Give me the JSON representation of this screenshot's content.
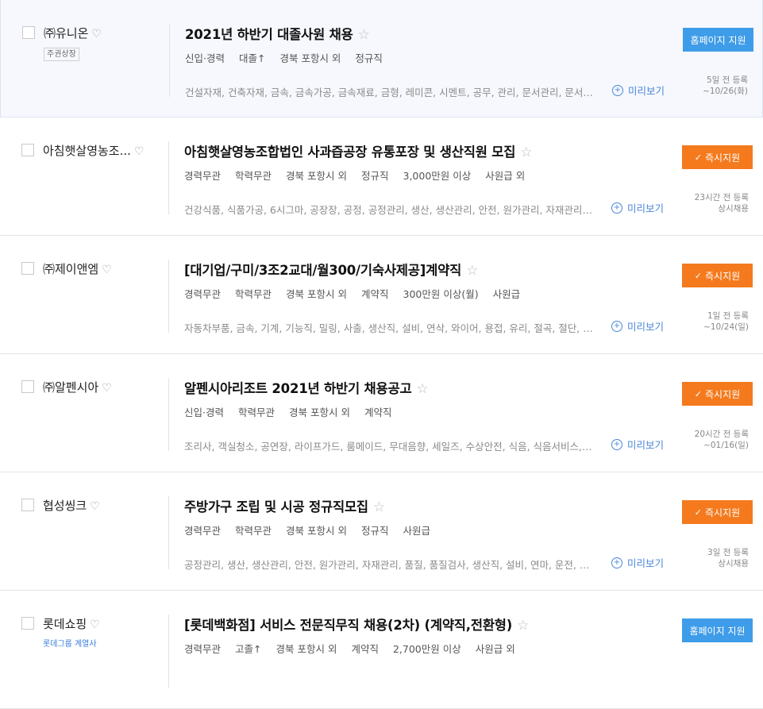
{
  "jobs": [
    {
      "company": "㈜유니온",
      "tag": "주권상장",
      "tag_type": "listed",
      "title": "2021년 하반기 대졸사원 채용",
      "conditions": [
        "신입·경력",
        "대졸↑",
        "경북 포항시 외",
        "정규직"
      ],
      "keywords": "건설자재, 건축자재, 금속, 금속가공, 금속재료, 금형, 레미콘, 시멘트, 공무, 관리, 문서관리, 문서수...",
      "preview_label": "미리보기",
      "button_label": "홈페이지 지원",
      "button_type": "home",
      "posted": "5일 전 등록",
      "deadline": "~10/26(화)"
    },
    {
      "company": "아침햇살영농조...",
      "tag": "",
      "tag_type": "",
      "title": "아침햇살영농조합법인 사과즙공장 유통포장 및 생산직원 모집",
      "conditions": [
        "경력무관",
        "학력무관",
        "경북 포항시 외",
        "정규직",
        "3,000만원 이상",
        "사원급 외"
      ],
      "keywords": "건강식품, 식품가공, 6시그마, 공장장, 공정, 공정관리, 생산, 생산관리, 안전, 원가관리, 자재관리, 품...",
      "preview_label": "미리보기",
      "button_label": "즉시지원",
      "button_type": "apply",
      "posted": "23시간 전 등록",
      "deadline": "상시채용"
    },
    {
      "company": "㈜제이앤엠",
      "tag": "",
      "tag_type": "",
      "title": "[대기업/구미/3조2교대/월300/기숙사제공]계약직",
      "conditions": [
        "경력무관",
        "학력무관",
        "경북 포항시 외",
        "계약직",
        "300만원 이상(월)",
        "사원급"
      ],
      "keywords": "자동차부품, 금속, 기계, 기능직, 밀링, 사출, 생산직, 설비, 연삭, 와이어, 용접, 유리, 절곡, 절단, 제관,...",
      "preview_label": "미리보기",
      "button_label": "즉시지원",
      "button_type": "apply",
      "posted": "1일 전 등록",
      "deadline": "~10/24(일)"
    },
    {
      "company": "㈜알펜시아",
      "tag": "",
      "tag_type": "",
      "title": "알펜시아리조트 2021년 하반기 채용공고",
      "conditions": [
        "신입·경력",
        "학력무관",
        "경북 포항시 외",
        "계약직"
      ],
      "keywords": "조리사, 객실청소, 공연장, 라이프가드, 룸메이드, 무대음향, 세일즈, 수상안전, 식음, 식음서비스, 연...",
      "preview_label": "미리보기",
      "button_label": "즉시지원",
      "button_type": "apply",
      "posted": "20시간 전 등록",
      "deadline": "~01/16(일)"
    },
    {
      "company": "협성씽크",
      "tag": "",
      "tag_type": "",
      "title": "주방가구 조립 및 시공 정규직모집",
      "conditions": [
        "경력무관",
        "학력무관",
        "경북 포항시 외",
        "정규직",
        "사원급"
      ],
      "keywords": "공정관리, 생산, 생산관리, 안전, 원가관리, 자재관리, 품질, 품질검사, 생산직, 설비, 연마, 운전, 절곡,...",
      "preview_label": "미리보기",
      "button_label": "즉시지원",
      "button_type": "apply",
      "posted": "3일 전 등록",
      "deadline": "상시채용"
    },
    {
      "company": "롯데쇼핑",
      "tag": "롯데그룹 계열사",
      "tag_type": "group",
      "title": "[롯데백화점] 서비스 전문직무직 채용(2차) (계약직,전환형)",
      "conditions": [
        "경력무관",
        "고졸↑",
        "경북 포항시 외",
        "계약직",
        "2,700만원 이상",
        "사원급 외"
      ],
      "keywords": "",
      "preview_label": "",
      "button_label": "홈페이지 지원",
      "button_type": "home",
      "posted": "",
      "deadline": ""
    }
  ],
  "colors": {
    "home_button": "#3f9ce8",
    "apply_button": "#f47a1d",
    "preview_link": "#4a86d9",
    "highlight_row": "#f6f8fd"
  }
}
